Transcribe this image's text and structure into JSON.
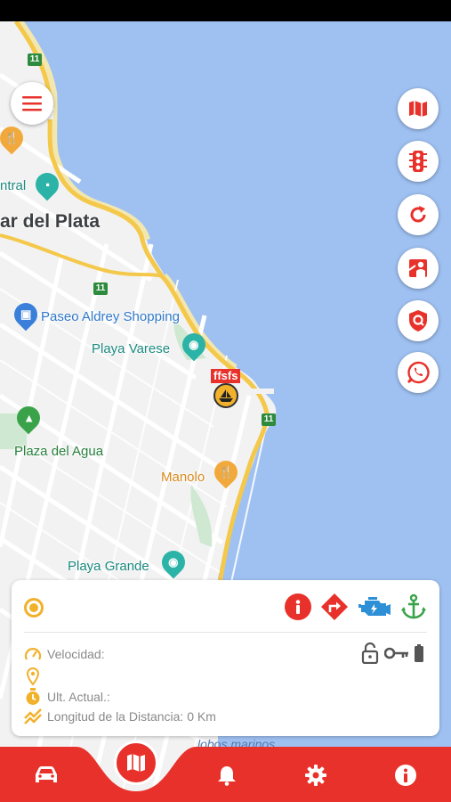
{
  "map": {
    "city_label": "ar del Plata",
    "places": {
      "central": "ntral",
      "shopping": "Paseo Aldrey Shopping",
      "playa_varese": "Playa Varese",
      "plaza": "Plaza del Agua",
      "manolo": "Manolo",
      "playa_grande": "Playa Grande",
      "lobos": "lobos marinos"
    },
    "road_number": "11",
    "vehicle_label": "ffsfs"
  },
  "right_actions": [
    {
      "name": "map-layers",
      "icon": "map-icon"
    },
    {
      "name": "traffic",
      "icon": "traffic-light-icon"
    },
    {
      "name": "refresh",
      "icon": "refresh-icon"
    },
    {
      "name": "street-view",
      "icon": "street-view-icon"
    },
    {
      "name": "geofence",
      "icon": "shield-pin-icon"
    },
    {
      "name": "whatsapp",
      "icon": "whatsapp-icon"
    }
  ],
  "panel": {
    "speed_label": "Velocidad:",
    "address_value": "",
    "last_update_label": "Ult. Actual.:",
    "distance_label": "Longitud de la Distancia: 0 Km"
  },
  "colors": {
    "accent": "#e8312a",
    "status_orange": "#f2b12b",
    "engine_blue": "#2d8fd5",
    "anchor_green": "#3aa34a",
    "water": "#9fc1f2"
  },
  "bottom_nav": [
    "car-icon",
    "map-icon",
    "bell-icon",
    "gear-icon",
    "info-icon"
  ]
}
